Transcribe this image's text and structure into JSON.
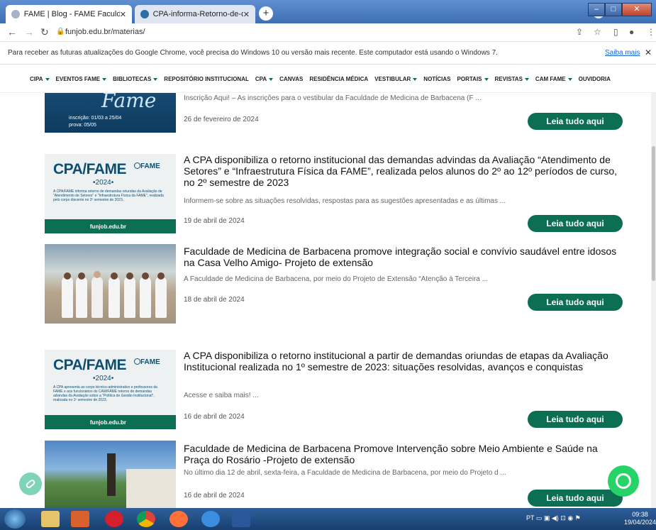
{
  "browser": {
    "tabs": [
      {
        "label": "FAME | Blog - FAME Faculdade de",
        "active": true
      },
      {
        "label": "CPA-informa-Retorno-de-deman",
        "active": false
      }
    ],
    "new_tab": "+",
    "url": "funjob.edu.br/materias/"
  },
  "infobar": {
    "message": "Para receber as futuras atualizações do Google Chrome, você precisa do Windows 10 ou versão mais recente. Este computador está usando o Windows 7.",
    "link": "Saiba mais",
    "close": "✕"
  },
  "menu": {
    "items": [
      {
        "label": "CIPA",
        "caret": true
      },
      {
        "label": "EVENTOS FAME",
        "caret": true
      },
      {
        "label": "BIBLIOTECAS",
        "caret": true
      },
      {
        "label": "REPOSITÓRIO INSTITUCIONAL",
        "caret": false
      },
      {
        "label": "CPA",
        "caret": true
      },
      {
        "label": "CANVAS",
        "caret": false
      },
      {
        "label": "RESIDÊNCIA MÉDICA",
        "caret": false
      },
      {
        "label": "VESTIBULAR",
        "caret": true
      },
      {
        "label": "NOTÍCIAS",
        "caret": false
      },
      {
        "label": "PORTAIS",
        "caret": true
      },
      {
        "label": "REVISTAS",
        "caret": true
      },
      {
        "label": "CAM FAME",
        "caret": true
      },
      {
        "label": "OUVIDORIA",
        "caret": false
      }
    ]
  },
  "posts": [
    {
      "excerpt": "Inscrição Aqui! – As inscrições para o vestibular da Faculdade de Medicina de Barbacena (F ...",
      "date": "26 de fevereiro de 2024",
      "button": "Leia tudo aqui",
      "thumb": {
        "script": "Fame",
        "line1": "inscrição: 01/03 a 25/04",
        "line2": "prova: 05/05"
      }
    },
    {
      "title": "A CPA disponibiliza  o retorno institucional das demandas advindas da Avaliação “Atendimento de Setores” e “Infraestrutura Física da FAME”, realizada pelos alunos do 2º ao 12º períodos de curso, no 2º semestre de 2023",
      "excerpt": "Informem-se sobre as situações resolvidas, respostas para as sugestões apresentadas e as últimas ...",
      "date": "19 de abril de 2024",
      "button": "Leia tudo aqui",
      "thumb": {
        "brand": "CPA/FAME",
        "year": "•2024•",
        "fame": "FAME",
        "text": "A CPA/FAME informa retorno de demandas oriundas da Avaliação de \"Atendimento de Setores\" e \"Infraestrutura Física da FAME\", realizada pelo corpo discente no 2º semestre de 2023.",
        "footer": "funjob.edu.br"
      }
    },
    {
      "title": "Faculdade de Medicina de Barbacena promove integração social e convívio saudável entre idosos na Casa Velho Amigo- Projeto de extensão",
      "excerpt": "A Faculdade de Medicina de Barbacena, por meio do Projeto de Extensão “Atenção à Terceira ...",
      "date": "18 de abril de 2024",
      "button": "Leia tudo aqui"
    },
    {
      "title": "A CPA disponibiliza o retorno institucional a partir de demandas oriundas de etapas da Avaliação Institucional realizada no 1º semestre de 2023: situações resolvidas, avanços e conquistas",
      "excerpt": "Acesse e saiba mais! ...",
      "date": "16 de abril de 2024",
      "button": "Leia tudo aqui",
      "thumb": {
        "brand": "CPA/FAME",
        "year": "•2024•",
        "fame": "FAME",
        "text": "A CPA apresenta ao corpo técnico-administrativo e professores da FAME e aos funcionários do CAM/FAME retorno de demandas advindas da Avaliação sobre a \"Política de Gestão Institucional\", realizada no 1º semestre de 2023.",
        "footer": "funjob.edu.br"
      }
    },
    {
      "title": "Faculdade de Medicina de Barbacena Promove Intervenção sobre Meio Ambiente e Saúde na Praça do Rosário -Projeto de extensão",
      "excerpt": "No último dia 12 de abril, sexta-feira, a Faculdade de Medicina de Barbacena, por meio do Projeto d ...",
      "date": "16 de abril de 2024",
      "button": "Leia tudo aqui"
    }
  ],
  "taskbar": {
    "lang": "PT",
    "time": "09:38",
    "date": "19/04/2024"
  },
  "colors": {
    "accent": "#0c6e52",
    "whatsapp": "#25d366"
  }
}
